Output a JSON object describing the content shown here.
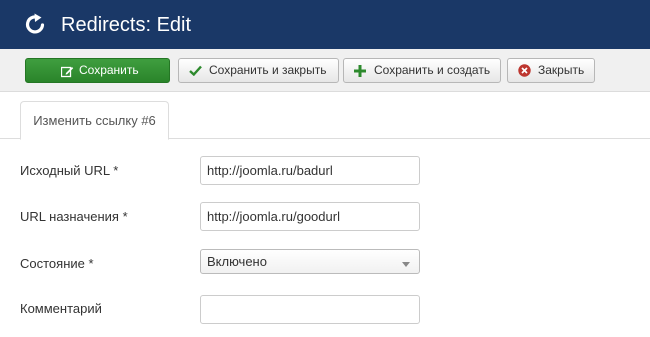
{
  "header": {
    "title": "Redirects: Edit",
    "logo_icon": "redirect-arrow-icon",
    "background": "#1a3867"
  },
  "toolbar": {
    "save_label": "Сохранить",
    "save_close_label": "Сохранить и закрыть",
    "save_new_label": "Сохранить и создать",
    "close_label": "Закрыть",
    "save_color": "#3f9e3f"
  },
  "tabs": [
    {
      "label": "Изменить ссылку #6",
      "active": true
    }
  ],
  "form": {
    "old_url": {
      "label": "Исходный URL *",
      "value": "http://joomla.ru/badurl"
    },
    "new_url": {
      "label": "URL назначения *",
      "value": "http://joomla.ru/goodurl"
    },
    "state": {
      "label": "Состояние *",
      "value": "Включено"
    },
    "comment": {
      "label": "Комментарий",
      "value": ""
    }
  }
}
